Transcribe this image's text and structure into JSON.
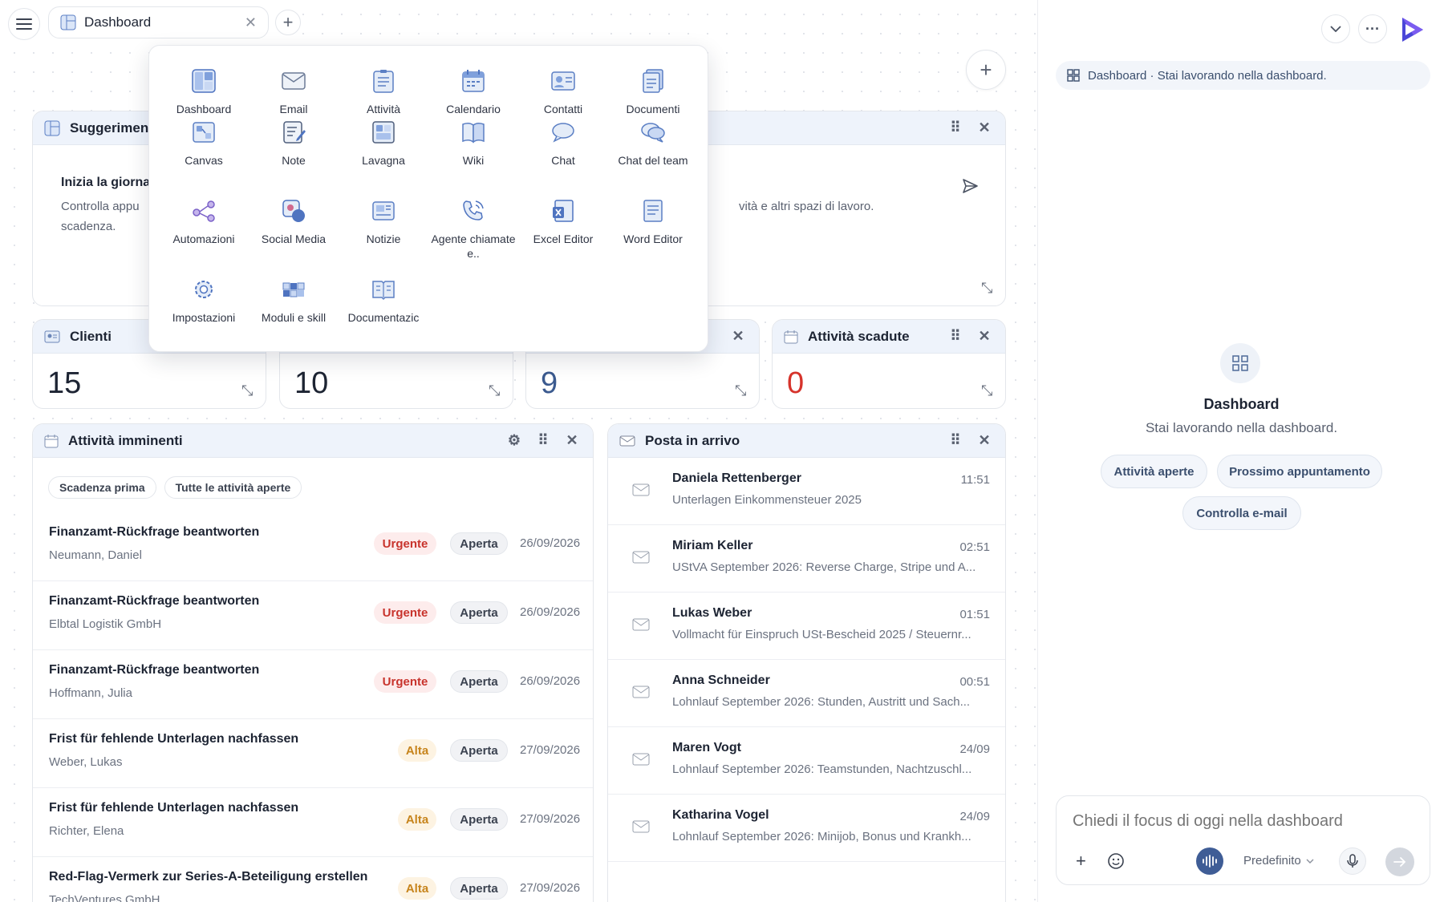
{
  "topbar": {
    "tab_label": "Dashboard",
    "close_glyph": "✕",
    "add_glyph": "+"
  },
  "add_widget_glyph": "+",
  "app_menu": [
    {
      "label": "Dashboard",
      "icon": "dashboard-icon"
    },
    {
      "label": "Email",
      "icon": "email-icon"
    },
    {
      "label": "Attività",
      "icon": "tasks-icon"
    },
    {
      "label": "Calendario",
      "icon": "calendar-icon"
    },
    {
      "label": "Contatti",
      "icon": "contacts-icon"
    },
    {
      "label": "Documenti",
      "icon": "documents-icon"
    },
    {
      "label": "Canvas",
      "icon": "canvas-icon"
    },
    {
      "label": "Note",
      "icon": "note-icon"
    },
    {
      "label": "Lavagna",
      "icon": "whiteboard-icon"
    },
    {
      "label": "Wiki",
      "icon": "wiki-icon"
    },
    {
      "label": "Chat",
      "icon": "chat-icon"
    },
    {
      "label": "Chat del team",
      "icon": "team-chat-icon"
    },
    {
      "label": "Automazioni",
      "icon": "automation-icon"
    },
    {
      "label": "Social Media",
      "icon": "social-media-icon"
    },
    {
      "label": "Notizie",
      "icon": "news-icon"
    },
    {
      "label": "Agente chiamate e..",
      "icon": "phone-agent-icon"
    },
    {
      "label": "Excel Editor",
      "icon": "excel-icon"
    },
    {
      "label": "Word Editor",
      "icon": "word-icon"
    },
    {
      "label": "Impostazioni",
      "icon": "settings-icon"
    },
    {
      "label": "Moduli e skill",
      "icon": "modules-icon"
    },
    {
      "label": "Documentazic",
      "icon": "documentation-icon"
    }
  ],
  "suggestions_card": {
    "title": "Suggeriment",
    "heading": "Inizia la giorna",
    "text_line1": "Controlla appu",
    "text_line2": "scadenza.",
    "text_right": "vità e altri spazi di lavoro."
  },
  "stats": [
    {
      "title": "Clienti",
      "value": "15",
      "color": "#1d2433"
    },
    {
      "title": "",
      "value": "10",
      "color": "#1d2433"
    },
    {
      "title": "",
      "value": "9",
      "color": "#3b5a8f"
    },
    {
      "title": "Attività scadute",
      "value": "0",
      "color": "#d6332b"
    }
  ],
  "tasks": {
    "title": "Attività imminenti",
    "filters": [
      "Scadenza prima",
      "Tutte le attività aperte"
    ],
    "rows": [
      {
        "title": "Finanzamt-Rückfrage beantworten",
        "sub": "Neumann, Daniel",
        "priority": "Urgente",
        "status": "Aperta",
        "date": "26/09/2026"
      },
      {
        "title": "Finanzamt-Rückfrage beantworten",
        "sub": "Elbtal Logistik GmbH",
        "priority": "Urgente",
        "status": "Aperta",
        "date": "26/09/2026"
      },
      {
        "title": "Finanzamt-Rückfrage beantworten",
        "sub": "Hoffmann, Julia",
        "priority": "Urgente",
        "status": "Aperta",
        "date": "26/09/2026"
      },
      {
        "title": "Frist für fehlende Unterlagen nachfassen",
        "sub": "Weber, Lukas",
        "priority": "Alta",
        "status": "Aperta",
        "date": "27/09/2026"
      },
      {
        "title": "Frist für fehlende Unterlagen nachfassen",
        "sub": "Richter, Elena",
        "priority": "Alta",
        "status": "Aperta",
        "date": "27/09/2026"
      },
      {
        "title": "Red-Flag-Vermerk zur Series-A-Beteiligung erstellen",
        "sub": "TechVentures GmbH",
        "priority": "Alta",
        "status": "Aperta",
        "date": "27/09/2026"
      }
    ]
  },
  "inbox": {
    "title": "Posta in arrivo",
    "rows": [
      {
        "name": "Daniela Rettenberger",
        "time": "11:51",
        "subject": "Unterlagen Einkommensteuer 2025"
      },
      {
        "name": "Miriam Keller",
        "time": "02:51",
        "subject": "UStVA September 2026: Reverse Charge, Stripe und A..."
      },
      {
        "name": "Lukas Weber",
        "time": "01:51",
        "subject": "Vollmacht für Einspruch USt-Bescheid 2025 / Steuernr..."
      },
      {
        "name": "Anna Schneider",
        "time": "00:51",
        "subject": "Lohnlauf September 2026: Stunden, Austritt und Sach..."
      },
      {
        "name": "Maren Vogt",
        "time": "24/09",
        "subject": "Lohnlauf September 2026: Teamstunden, Nachtzuschl..."
      },
      {
        "name": "Katharina Vogel",
        "time": "24/09",
        "subject": "Lohnlauf September 2026: Minijob, Bonus und Krankh..."
      }
    ]
  },
  "assistant": {
    "context_label": "Dashboard · Stai lavorando nella dashboard.",
    "center_title": "Dashboard",
    "center_sub": "Stai lavorando nella dashboard.",
    "suggestions": [
      "Attività aperte",
      "Prossimo appuntamento",
      "Controlla e-mail"
    ],
    "input_placeholder": "Chiedi il focus di oggi nella dashboard",
    "model_label": "Predefinito"
  }
}
